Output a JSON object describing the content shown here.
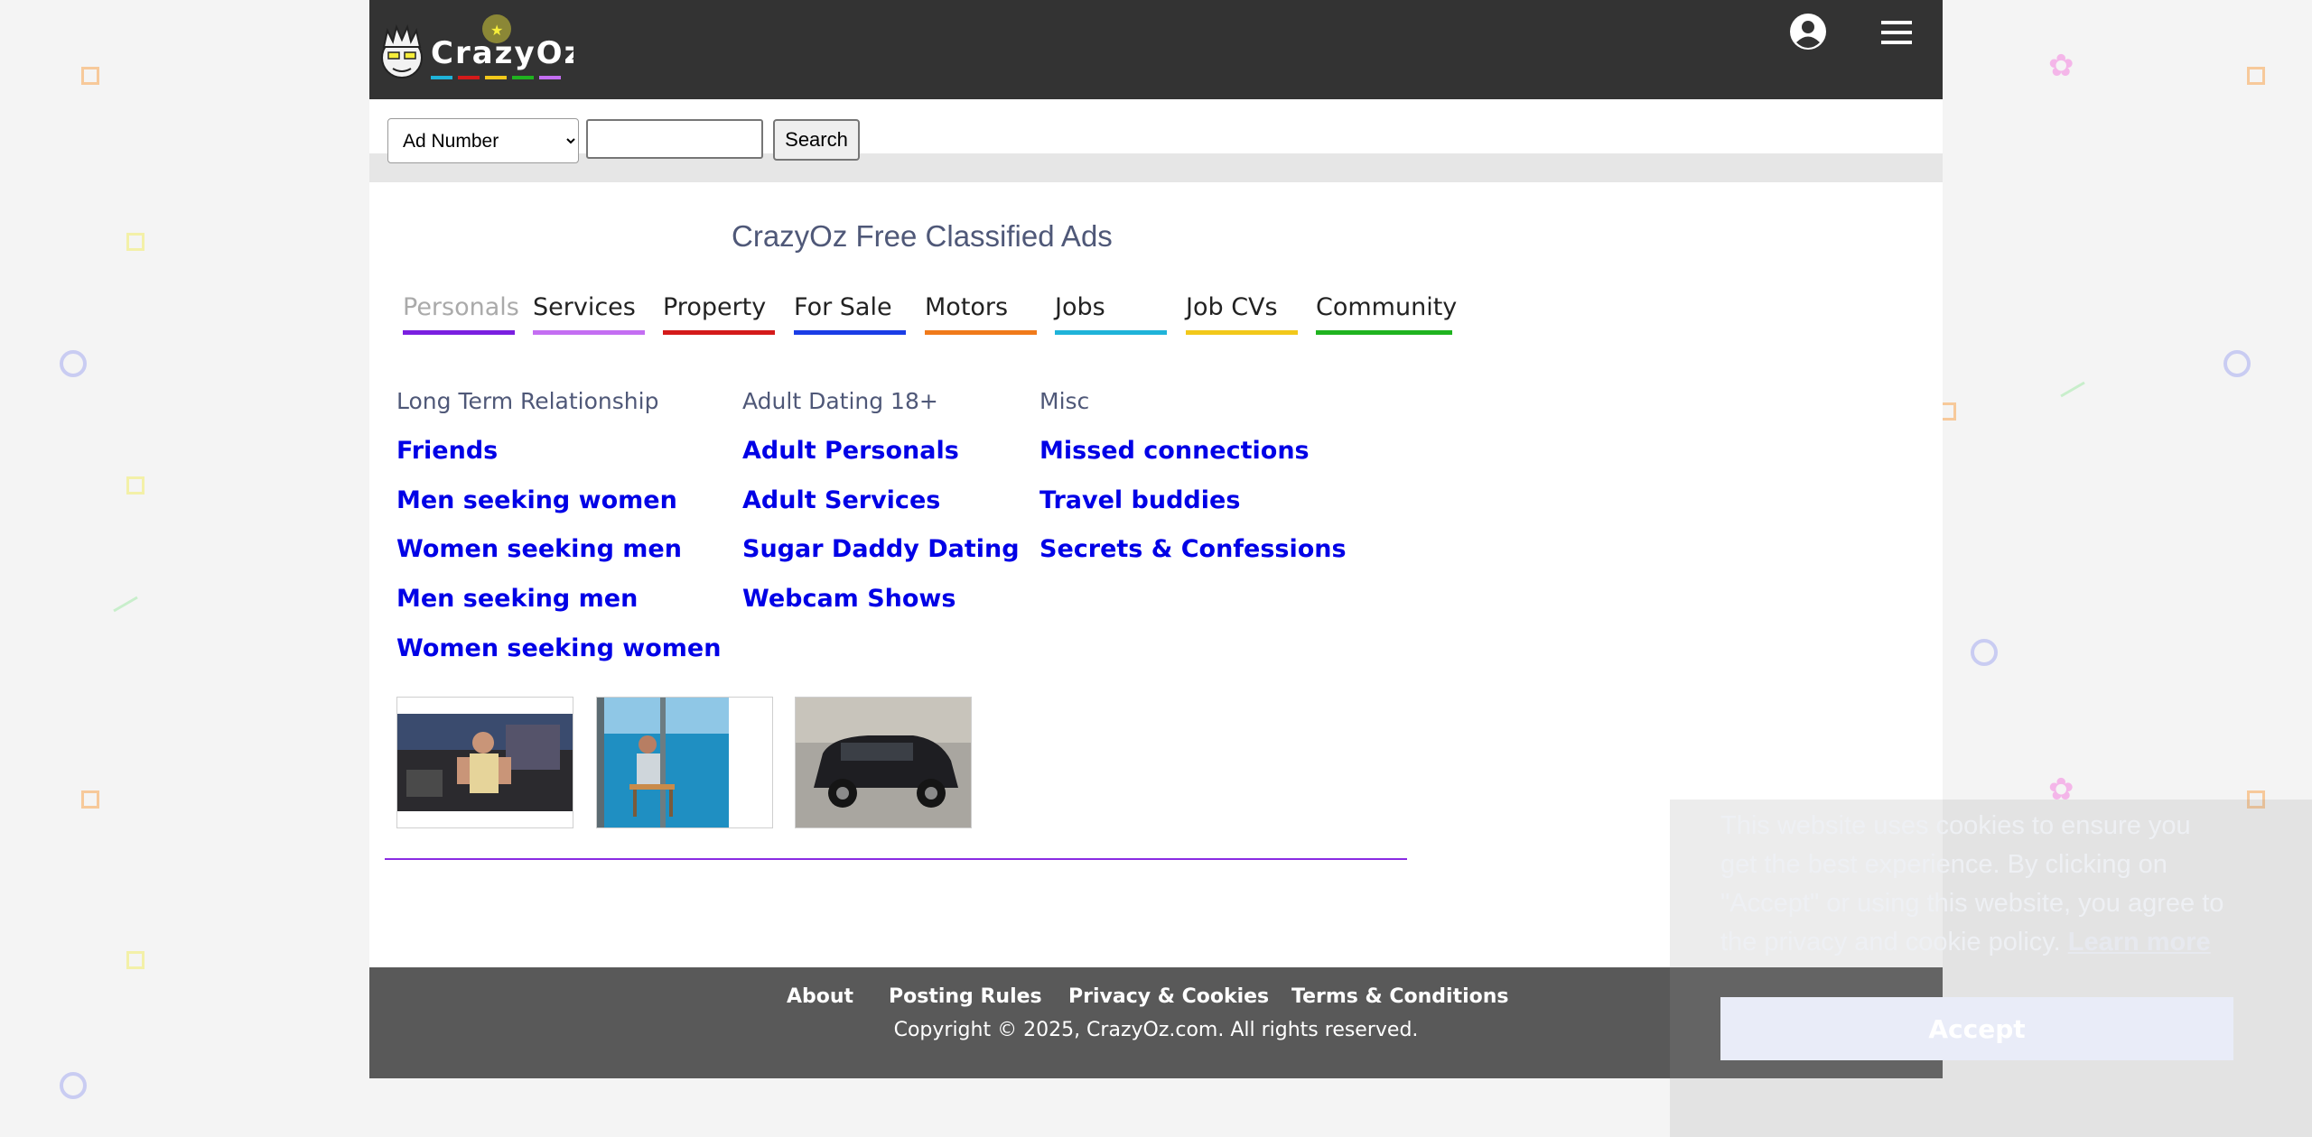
{
  "header": {
    "logo_text": "CrazyOz",
    "user_icon": "account-circle-icon",
    "menu_icon": "hamburger-menu-icon"
  },
  "search": {
    "selected_option": "Ad Number",
    "options": [
      "Ad Number"
    ],
    "input_value": "",
    "button_label": "Search"
  },
  "main": {
    "title": "CrazyOz Free Classified Ads",
    "tabs": [
      {
        "label": "Personals",
        "color": "#7a1fe0",
        "active": true
      },
      {
        "label": "Services",
        "color": "#c46ef2"
      },
      {
        "label": "Property",
        "color": "#d41a1a"
      },
      {
        "label": "For Sale",
        "color": "#1a3de6"
      },
      {
        "label": "Motors",
        "color": "#f07a1a"
      },
      {
        "label": "Jobs",
        "color": "#1fb3d9"
      },
      {
        "label": "Job CVs",
        "color": "#f2c81a"
      },
      {
        "label": "Community",
        "color": "#1fb31f"
      }
    ],
    "columns": [
      {
        "heading": "Long Term Relationship",
        "links": [
          "Friends",
          "Men seeking women",
          "Women seeking men",
          "Men seeking men",
          "Women seeking women"
        ]
      },
      {
        "heading": "Adult Dating 18+",
        "links": [
          "Adult Personals",
          "Adult Services",
          "Sugar Daddy Dating",
          "Webcam Shows"
        ]
      },
      {
        "heading": "Misc",
        "links": [
          "Missed connections",
          "Travel buddies",
          "Secrets & Confessions"
        ]
      }
    ],
    "thumbnails": [
      "gym-photo",
      "balcony-photo",
      "car-photo"
    ]
  },
  "footer": {
    "links": [
      "About",
      "Posting Rules",
      "Privacy & Cookies",
      "Terms & Conditions"
    ],
    "copyright": "Copyright © 2025, CrazyOz.com. All rights reserved."
  },
  "cookie": {
    "text": "This website uses cookies to ensure you get the best experience. By clicking on \"Accept\" or using this website, you agree to the privacy and cookie policy.",
    "learn_more": "Learn more",
    "accept": "Accept"
  },
  "colors": {
    "header_bg": "#333333",
    "footer_bg": "#595959",
    "link": "#0000e6",
    "divider": "#8a2be2"
  }
}
